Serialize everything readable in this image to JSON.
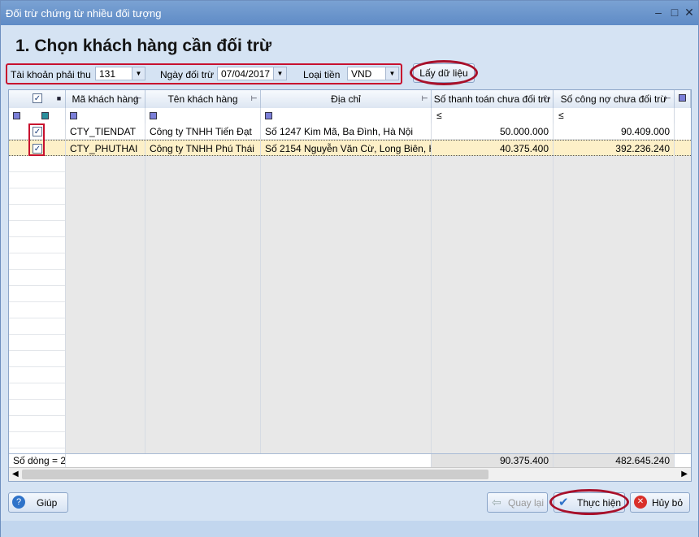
{
  "window": {
    "title": "Đối trừ chứng từ nhiều đối tượng",
    "minimize_icon": "minimize-icon",
    "maximize_icon": "maximize-icon",
    "close_icon": "close-icon"
  },
  "heading": "1. Chọn khách hàng cần đối trừ",
  "filters": {
    "account_label": "Tài khoản phải thu",
    "account_value": "131",
    "date_label": "Ngày đối trừ",
    "date_value": "07/04/2017",
    "currency_label": "Loại tiền",
    "currency_value": "VND"
  },
  "fetch_button": "Lấy dữ liệu",
  "grid": {
    "columns": [
      "Mã khách hàng",
      "Tên khách hàng",
      "Địa chỉ",
      "Số thanh toán chưa đối trừ",
      "Số công nợ chưa đối trừ"
    ],
    "filter_ops": [
      "≤",
      "≤"
    ],
    "rows": [
      {
        "checked": true,
        "code": "CTY_TIENDAT",
        "name": "Công ty TNHH Tiến Đạt",
        "address": "Số 1247 Kim Mã, Ba Đình, Hà Nội",
        "payment": "50.000.000",
        "debt": "90.409.000"
      },
      {
        "checked": true,
        "code": "CTY_PHUTHAI",
        "name": "Công ty TNHH Phú Thái",
        "address": "Số 2154 Nguyễn Văn Cừ, Long Biên, H",
        "payment": "40.375.400",
        "debt": "392.236.240"
      }
    ],
    "footer": {
      "row_count": "Số dòng = 2",
      "total_payment": "90.375.400",
      "total_debt": "482.645.240"
    }
  },
  "buttons": {
    "help": "Giúp",
    "back": "Quay lại",
    "execute": "Thực hiện",
    "cancel": "Hủy bỏ"
  },
  "colors": {
    "selected_row": "#fdf0c8",
    "accent": "#c8102e"
  }
}
